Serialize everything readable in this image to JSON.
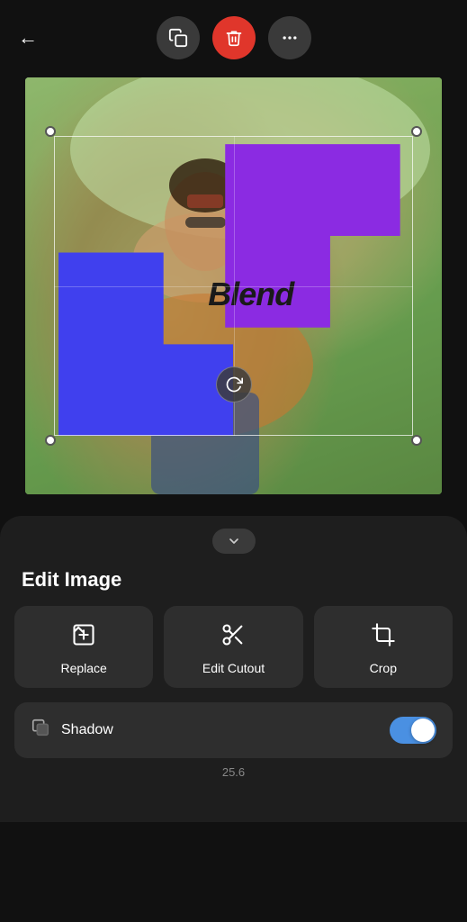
{
  "topBar": {
    "backLabel": "←",
    "copyLabel": "⧉",
    "deleteLabel": "🗑",
    "moreLabel": "•••"
  },
  "canvas": {
    "blendText": "Blend"
  },
  "bottomPanel": {
    "collapseIcon": "∨",
    "sectionTitle": "Edit Image",
    "buttons": [
      {
        "id": "replace",
        "icon": "⊞",
        "label": "Replace"
      },
      {
        "id": "edit-cutout",
        "icon": "✂",
        "label": "Edit Cutout"
      },
      {
        "id": "crop",
        "icon": "⊡",
        "label": "Crop"
      }
    ],
    "shadow": {
      "icon": "▣",
      "label": "Shadow",
      "value": "25.6",
      "enabled": true
    }
  }
}
